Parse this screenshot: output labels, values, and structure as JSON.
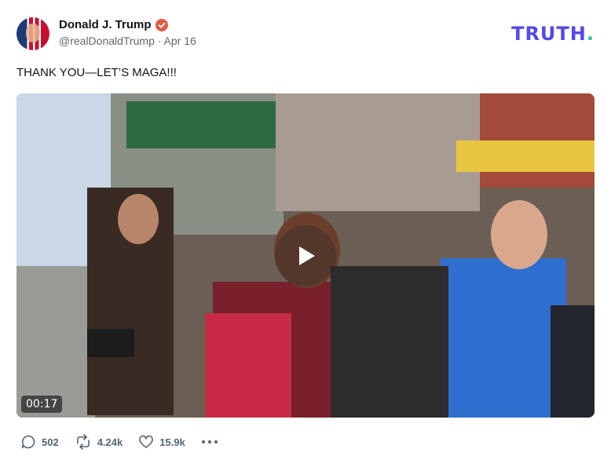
{
  "author": {
    "name": "Donald J. Trump",
    "handle": "@realDonaldTrump",
    "separator": "·",
    "date": "Apr 16"
  },
  "brand": {
    "logo_text": "TRUTH",
    "logo_dot": ".",
    "logo_color": "#5448ee",
    "dot_color": "#16c79a"
  },
  "post": {
    "text": "THANK YOU—LET’S MAGA!!!"
  },
  "video": {
    "duration": "00:17"
  },
  "actions": {
    "replies": "502",
    "retruths": "4.24k",
    "likes": "15.9k"
  },
  "colors": {
    "verified_badge": "#e05a47",
    "muted_text": "#606770"
  },
  "icons": [
    "verified-icon",
    "play-icon",
    "reply-icon",
    "retruth-icon",
    "heart-icon",
    "more-icon"
  ]
}
